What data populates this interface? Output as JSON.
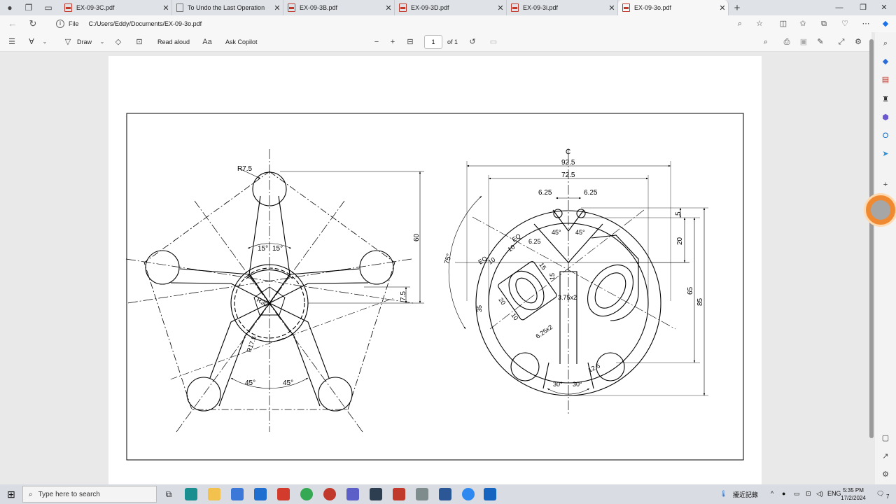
{
  "browser": {
    "tabs": [
      {
        "label": "EX-09-3C.pdf",
        "icon": "pdf-icon",
        "active": false
      },
      {
        "label": "To Undo the Last Operation",
        "icon": "document-icon",
        "active": false
      },
      {
        "label": "EX-09-3B.pdf",
        "icon": "pdf-icon",
        "active": false
      },
      {
        "label": "EX-09-3D.pdf",
        "icon": "pdf-icon",
        "active": false
      },
      {
        "label": "EX-09-3i.pdf",
        "icon": "pdf-icon",
        "active": false
      },
      {
        "label": "EX-09-3o.pdf",
        "icon": "pdf-icon",
        "active": true
      }
    ],
    "close_glyph": "✕",
    "new_tab_glyph": "+",
    "address": {
      "protocol": "File",
      "path": "C:/Users/Eddy/Documents/EX-09-3o.pdf"
    }
  },
  "pdf_toolbar": {
    "draw_label": "Draw",
    "read_aloud_label": "Read aloud",
    "ask_copilot_label": "Ask Copilot",
    "page_number": "1",
    "page_count": "of 1",
    "zoom_out": "−",
    "zoom_in": "+"
  },
  "drawing_labels": {
    "left": {
      "r75": "R7.5",
      "d60": "60",
      "a15a": "15°",
      "a15b": "15°",
      "d75": "7.5",
      "r30": "R30",
      "r17": "R17.5",
      "a45a": "45°",
      "a45b": "45°"
    },
    "right": {
      "cl": "₵",
      "d925": "92.5",
      "d725": "72.5",
      "d625a": "6.25",
      "d625b": "6.25",
      "d5": "5",
      "d20": "20",
      "d65": "65",
      "d85": "85",
      "a75": "75°",
      "a45a": "45°",
      "a45b": "45°",
      "d625c": "6.25",
      "eq1": "EQ",
      "eq2": "EQ",
      "d10a": "10",
      "d10b": "10",
      "d15a": "15",
      "d15b": "15",
      "d375": "3.75x2",
      "d35": "35",
      "d20b": "20",
      "d10c": "10",
      "d625x2": "6.25x2",
      "d125": "12.5",
      "a30a": "30°",
      "a30b": "30°"
    }
  },
  "taskbar": {
    "search_placeholder": "Type here to search",
    "tray_text": "擾近記錄",
    "lang": "ENG",
    "time": "5:35 PM",
    "date": "17/2/2024",
    "notification_count": "7"
  }
}
